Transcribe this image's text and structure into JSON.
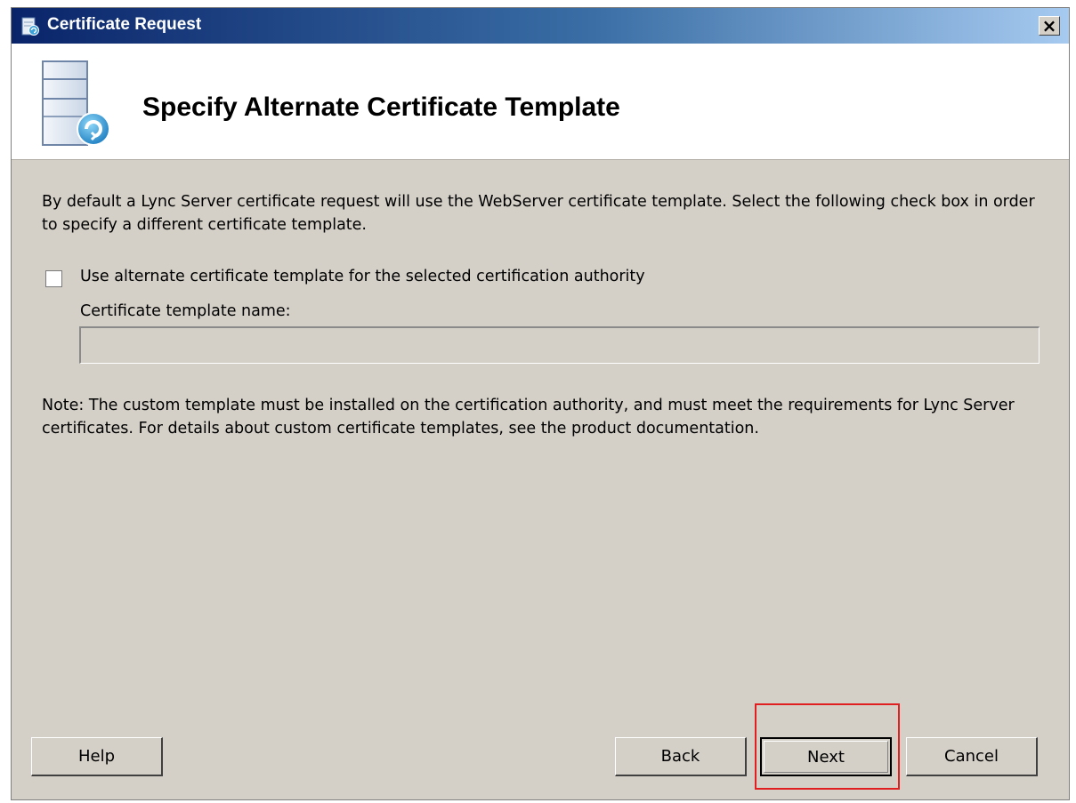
{
  "window": {
    "title": "Certificate Request",
    "close_glyph": "×",
    "close_icon": "close-icon",
    "title_icon": "certificate-request-icon"
  },
  "header": {
    "title": "Specify Alternate Certificate Template",
    "icon": "server-certificate-icon"
  },
  "body": {
    "intro": "By default a Lync Server certificate request will use the WebServer certificate template. Select the following check box in order to specify a different certificate template.",
    "checkbox_label": "Use alternate certificate template for the selected certification authority",
    "checkbox_checked": false,
    "field_label": "Certificate template name:",
    "field_value": "",
    "note": "Note: The custom template must be installed on the certification authority, and must meet the requirements for Lync Server certificates. For details about custom certificate templates, see the product documentation."
  },
  "buttons": {
    "help": "Help",
    "back": "Back",
    "next": "Next",
    "cancel": "Cancel"
  },
  "colors": {
    "titlebar_start": "#0a246a",
    "titlebar_end": "#a6caf0",
    "dialog_bg": "#d4d0c8",
    "highlight": "#e02020"
  }
}
